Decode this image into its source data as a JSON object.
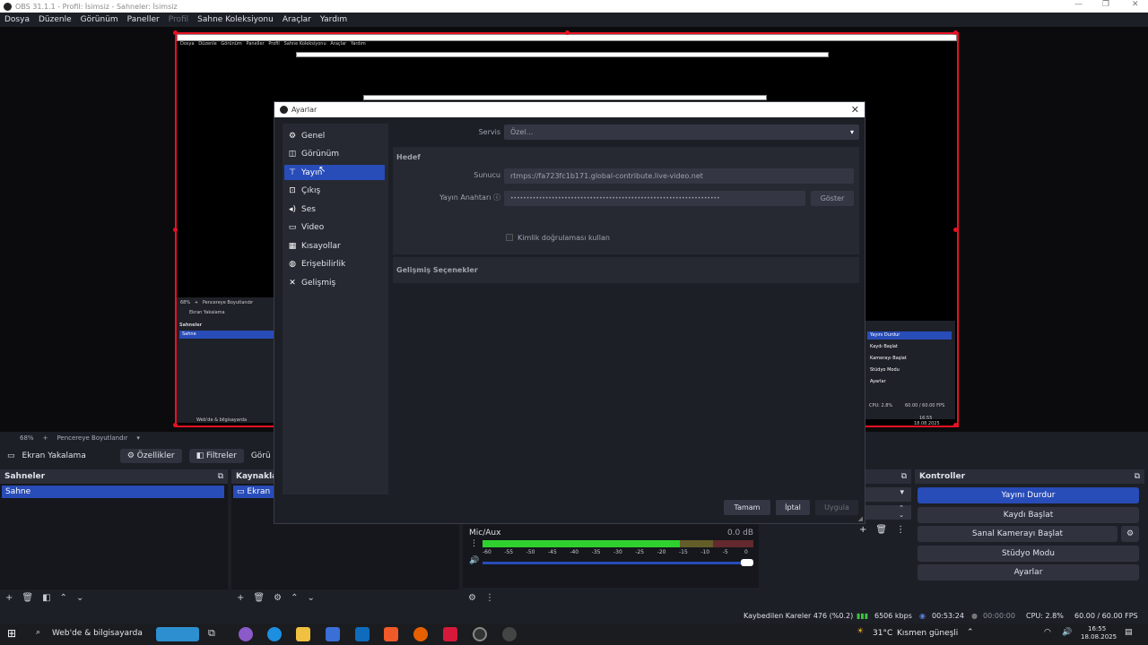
{
  "app": {
    "window_title": "OBS 31.1.1 - Profil: İsimsiz - Sahneler: İsimsiz"
  },
  "menu": [
    "Dosya",
    "Düzenle",
    "Görünüm",
    "Paneller",
    "Profil",
    "Sahne Koleksiyonu",
    "Araçlar",
    "Yardım"
  ],
  "preview": {
    "zoom": "68%",
    "plus": "+",
    "fit_label": "Pencereye Boyutlandır",
    "mini_source": "Ekran Yakalama",
    "mini_scenes_header": "Sahneler",
    "mini_scene": "Sahne",
    "mini_controls": [
      "Yayını Durdur",
      "Kaydı Başlat",
      "Kamerayı Başlat",
      "Stüdyo Modu",
      "Ayarlar"
    ],
    "mini_status": "CPU: 2.8%",
    "mini_fps": "60.00 / 60.00 FPS",
    "mini_search": "Web'de & bilgisayarda",
    "mini_time": "16:55",
    "mini_date": "18.08.2025"
  },
  "source_toolbar": {
    "source_name": "Ekran Yakalama",
    "properties": "Özellikler",
    "filters": "Filtreler",
    "truncated": "Görü"
  },
  "docks": {
    "scenes": {
      "title": "Sahneler",
      "items": [
        "Sahne"
      ]
    },
    "sources": {
      "title": "Kaynakla",
      "items": [
        "Ekran"
      ]
    },
    "mixer": {
      "channel": "Mic/Aux",
      "db": "0.0 dB",
      "scale": [
        "-60",
        "-55",
        "-50",
        "-45",
        "-40",
        "-35",
        "-30",
        "-25",
        "-20",
        "-15",
        "-10",
        "-5",
        "0"
      ],
      "level": 0.73
    },
    "controls": {
      "title": "Kontroller",
      "buttons": [
        "Yayını Durdur",
        "Kaydı Başlat",
        "Sanal Kamerayı Başlat",
        "Stüdyo Modu",
        "Ayarlar"
      ]
    }
  },
  "status": {
    "dropped": "Kaybedilen Kareler 476 (%0.2)",
    "bitrate": "6506 kbps",
    "stream_time": "00:53:24",
    "rec_time": "00:00:00",
    "cpu": "CPU: 2.8%",
    "fps": "60.00 / 60.00 FPS"
  },
  "taskbar": {
    "search": "Web'de & bilgisayarda",
    "weather": "31°C",
    "weather_desc": "Kısmen güneşli",
    "time": "16:55",
    "date": "18.08.2025"
  },
  "settings": {
    "title": "Ayarlar",
    "categories": [
      "Genel",
      "Görünüm",
      "Yayın",
      "Çıkış",
      "Ses",
      "Video",
      "Kısayollar",
      "Erişebilirlik",
      "Gelişmiş"
    ],
    "active_index": 2,
    "service_label": "Servis",
    "service_value": "Özel...",
    "target_header": "Hedef",
    "server_label": "Sunucu",
    "server_value": "rtmps://fa723fc1b171.global-contribute.live-video.net",
    "key_label": "Yayın Anahtarı",
    "key_value": "••••••••••••••••••••••••••••••••••••••••••••••••••••••••••••••••••",
    "show_button": "Göster",
    "auth_checkbox": "Kimlik doğrulaması kullan",
    "advanced_header": "Gelişmiş Seçenekler",
    "ok": "Tamam",
    "cancel": "İptal",
    "apply": "Uygula"
  },
  "colors": {
    "accent": "#284cb8",
    "background": "#1d1f26",
    "selection_red": "#e81123"
  }
}
